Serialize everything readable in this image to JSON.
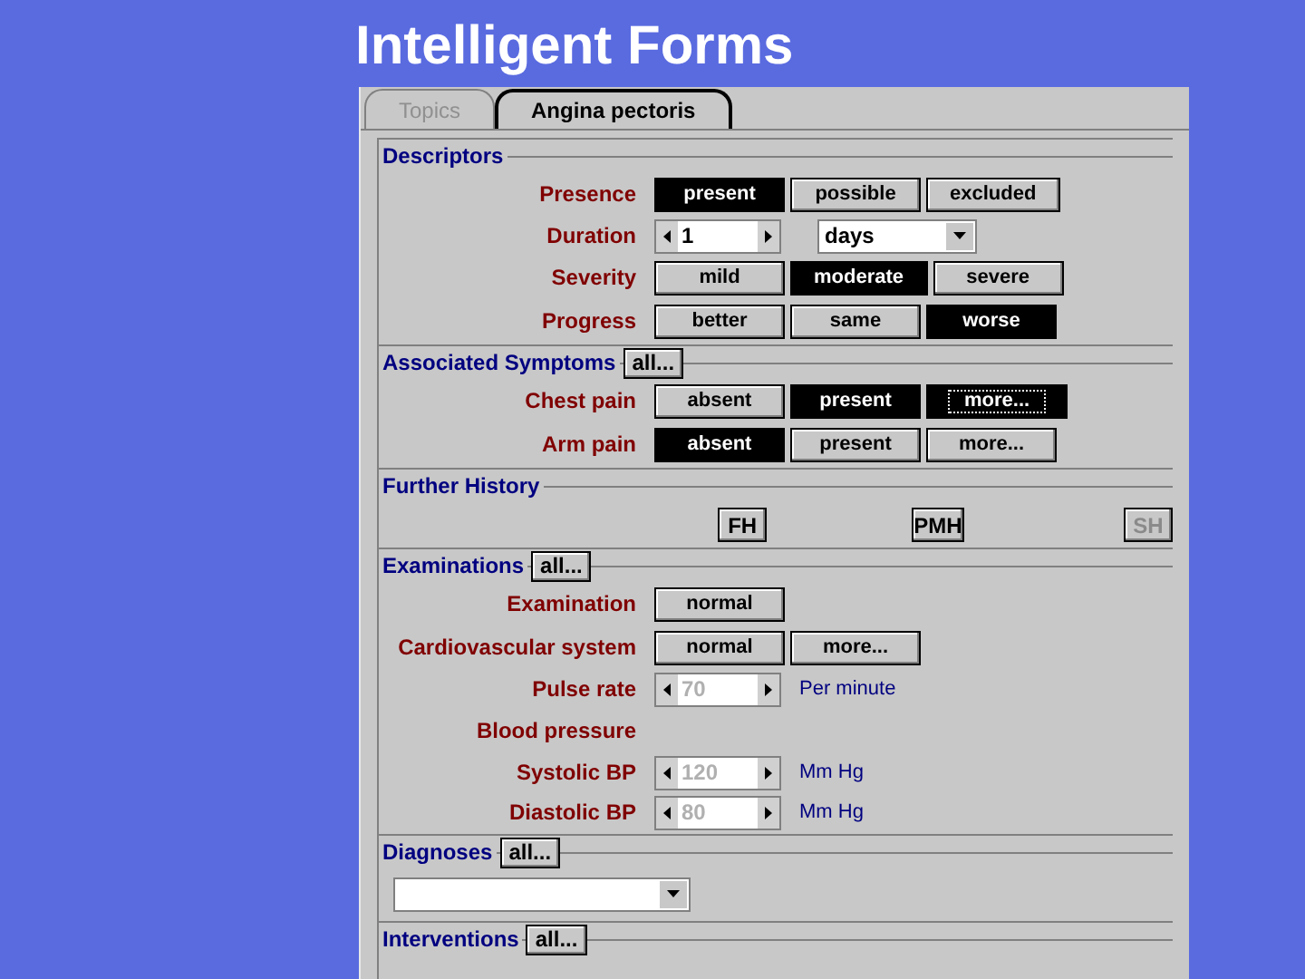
{
  "title": "Intelligent Forms",
  "tabs": [
    {
      "label": "Topics",
      "selected": false
    },
    {
      "label": "Angina pectoris",
      "selected": true
    }
  ],
  "sections": [
    {
      "title": "Descriptors",
      "rows": [
        {
          "kind": "choice",
          "label": "Presence",
          "options": [
            {
              "label": "present",
              "selected": true,
              "focused": false
            },
            {
              "label": "possible",
              "selected": false,
              "focused": false
            },
            {
              "label": "excluded",
              "selected": false,
              "focused": false
            }
          ]
        },
        {
          "kind": "spinner",
          "label": "Duration",
          "value": "1",
          "disabled": false,
          "dropdown": "days"
        },
        {
          "kind": "choice",
          "label": "Severity",
          "options": [
            {
              "label": "mild",
              "selected": false,
              "focused": false
            },
            {
              "label": "moderate",
              "selected": true,
              "focused": false
            },
            {
              "label": "severe",
              "selected": false,
              "focused": false
            }
          ]
        },
        {
          "kind": "choice",
          "label": "Progress",
          "options": [
            {
              "label": "better",
              "selected": false,
              "focused": false
            },
            {
              "label": "same",
              "selected": false,
              "focused": false
            },
            {
              "label": "worse",
              "selected": true,
              "focused": false
            }
          ]
        }
      ]
    },
    {
      "title": "Associated Symptoms",
      "all_button": "all...",
      "rows": [
        {
          "kind": "choice",
          "label": "Chest pain",
          "options": [
            {
              "label": "absent",
              "selected": false,
              "focused": false
            },
            {
              "label": "present",
              "selected": true,
              "focused": false
            },
            {
              "label": "more...",
              "selected": true,
              "focused": true
            }
          ]
        },
        {
          "kind": "choice",
          "label": "Arm pain",
          "options": [
            {
              "label": "absent",
              "selected": true,
              "focused": false
            },
            {
              "label": "present",
              "selected": false,
              "focused": false
            },
            {
              "label": "more...",
              "selected": false,
              "focused": false
            }
          ]
        }
      ]
    },
    {
      "title": "Further History",
      "rows": [
        {
          "kind": "buttons",
          "buttons": [
            {
              "label": "FH",
              "disabled": false
            },
            {
              "label": "PMH",
              "disabled": false
            },
            {
              "label": "SH",
              "disabled": true
            }
          ]
        }
      ]
    },
    {
      "title": "Examinations",
      "all_button": "all...",
      "rows": [
        {
          "kind": "choice",
          "label": "Examination",
          "options": [
            {
              "label": "normal",
              "selected": false,
              "focused": false
            }
          ]
        },
        {
          "kind": "choice",
          "label": "Cardiovascular system",
          "options": [
            {
              "label": "normal",
              "selected": false,
              "focused": false
            },
            {
              "label": "more...",
              "selected": false,
              "focused": false
            }
          ]
        },
        {
          "kind": "spinner",
          "label": "Pulse rate",
          "value": "70",
          "disabled": true,
          "unit": "Per minute"
        },
        {
          "kind": "heading",
          "label": "Blood pressure"
        },
        {
          "kind": "spinner",
          "label": "Systolic BP",
          "value": "120",
          "disabled": true,
          "unit": "Mm Hg"
        },
        {
          "kind": "spinner",
          "label": "Diastolic BP",
          "value": "80",
          "disabled": true,
          "unit": "Mm Hg"
        }
      ]
    },
    {
      "title": "Diagnoses",
      "all_button": "all...",
      "rows": [
        {
          "kind": "dropdown"
        }
      ]
    },
    {
      "title": "Interventions",
      "all_button": "all..."
    }
  ]
}
